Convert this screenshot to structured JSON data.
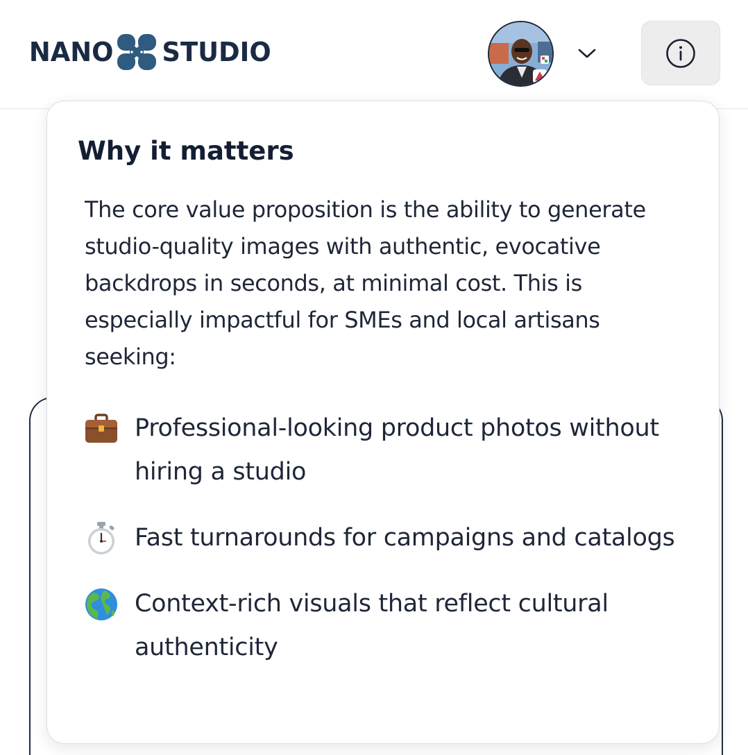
{
  "header": {
    "logo": {
      "left": "NANO",
      "right": "STUDIO"
    },
    "avatar_alt": "user-avatar",
    "menu_icon": "chevron-down-icon",
    "info_icon": "info-circle-icon"
  },
  "popover": {
    "title": "Why it matters",
    "body": "The core value proposition is the ability to generate studio-quality images with authentic, evocative backdrops in seconds, at minimal cost. This is especially impactful for SMEs and local artisans seeking:",
    "items": [
      {
        "icon": "briefcase-icon",
        "text": "Professional-looking product photos without hiring a studio"
      },
      {
        "icon": "stopwatch-icon",
        "text": "Fast turnarounds for campaigns and catalogs"
      },
      {
        "icon": "globe-icon",
        "text": "Context-rich visuals that reflect cultural authenticity"
      }
    ]
  },
  "colors": {
    "brand_text": "#1b2a44",
    "logo_mark": "#2f5b80",
    "info_button_bg": "#ededee"
  }
}
